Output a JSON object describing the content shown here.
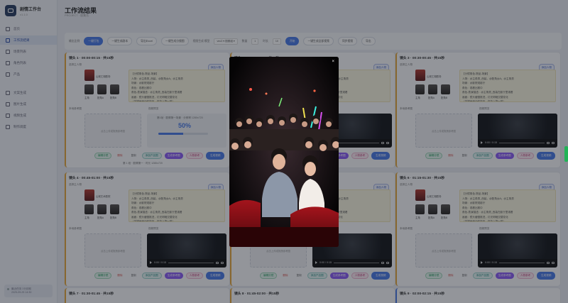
{
  "app": {
    "name": "剧情工作台",
    "version": "v1.1.0"
  },
  "sidebar": {
    "items": [
      {
        "label": "首页"
      },
      {
        "label": "工作流结果",
        "active": true
      },
      {
        "label": "场景列表"
      },
      {
        "label": "角色列表"
      },
      {
        "label": "产品"
      }
    ],
    "items2": [
      {
        "label": "文案生成"
      },
      {
        "label": "图片生成"
      },
      {
        "label": "视频生成"
      },
      {
        "label": "制作调度"
      }
    ],
    "footer": [
      "最近任务 2分钟前",
      "2025-09-25 14:30"
    ]
  },
  "header": {
    "title": "工作流结果",
    "subtitle": "PROJECT · 剧集名"
  },
  "toolbar": {
    "label_left": "输出比例",
    "btn_one_click": "一键打包",
    "btn_generate_all_script": "一键生成剧本",
    "btn_batch": "导出Excel",
    "btn_gen_img": "一键生成分镜图",
    "label_model": "视频生成 模型",
    "select_model": "veo3 ▾ 视频组 ▾",
    "label_count": "数量",
    "count_value": "1",
    "label_seconds": "时长",
    "seconds_value": "10",
    "btn_confirm": "开始",
    "btn_generate_all_video": "一键生成全部视频",
    "btn_sync": "同步视频",
    "btn_more": "导出"
  },
  "labels": {
    "bind_role": "选择主人物",
    "add_role": "添加人物",
    "upload_ref": "本地参考图",
    "video_label": "视频预览",
    "dropzone": "点击上传或拖拽参考图",
    "progress_msg": "第1帧 · 剧情第一场景 · 分辨率 1280x720",
    "progress_note": "第 1 段 · 剧情第一 · 时长 1280x720"
  },
  "progress": {
    "value": 0.5,
    "text": "50%"
  },
  "actions": {
    "edit": "编辑分镜",
    "delete": "删除",
    "copy": "复制",
    "product": "添加产品图",
    "gen_image": "生成参考图",
    "add_role": "人物参考",
    "gen_video": "生成视频"
  },
  "thumb_caps": {
    "scene": "山城江湖剧场",
    "scene2": "山城艺术剧院",
    "p1": "主角",
    "p2": "配角A",
    "p3": "配角B"
  },
  "script_text": [
    "【分镜角色-物品-场景】",
    "人物：@主角男_西装，@配角女A；@主角男",
    "场景：@影院观影厅",
    "角色：观看比赛中",
    "角色-表演描述：@主角男_西装在影厅里观看",
    "画面：镜头缓慢推进，灯光明暗交替变化",
    "（关键画面动作特写，保持人物一致）"
  ],
  "cards": [
    {
      "title": "镜头 1 · 00:00-00:15 · 共15秒",
      "state": "progress"
    },
    {
      "title": "镜头 2 · 00:15-00:30 · 共15秒",
      "state": "video"
    },
    {
      "title": "镜头 3 · 00:30-00:45 · 共15秒",
      "state": "video"
    },
    {
      "title": "镜头 4 · 00:45-01:00 · 共15秒",
      "state": "video"
    },
    {
      "title": "镜头 5 · 01:00-01:15 · 共15秒",
      "state": "video"
    },
    {
      "title": "镜头 6 · 01:15-01:30 · 共15秒",
      "state": "video"
    },
    {
      "title": "镜头 7 · 01:30-01:45 · 共15秒",
      "state": "none"
    },
    {
      "title": "镜头 8 · 01:45-02:00 · 共15秒",
      "state": "none"
    },
    {
      "title": "镜头 9 · 02:00-02:15 · 共15秒",
      "state": "none"
    }
  ],
  "video_time": "0:00 / 0:15",
  "modal": {
    "close": "×",
    "description": "A crowd of young people watching in a dark cinema, a man in a grey shirt and a woman in a white top at center, glow sticks in the background"
  },
  "colors": {
    "accent": "#4a7be8",
    "card_border": "#e7a83b",
    "overlay": "rgba(20,24,34,0.45)"
  }
}
